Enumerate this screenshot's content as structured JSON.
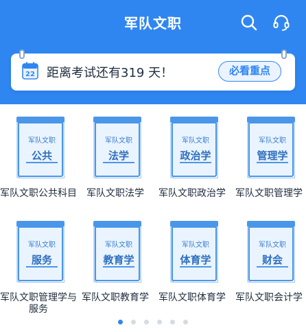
{
  "header": {
    "title": "军队文职",
    "icons": [
      "search-icon",
      "headset-icon"
    ],
    "background": "#2f86f1"
  },
  "countdown": {
    "calendar_day": "22",
    "text": "距离考试还有319 天！",
    "days": 319,
    "action_label": "必看重点"
  },
  "subjects": [
    {
      "sub": "军队文职",
      "main": "公共",
      "label": "军队文职公共科目"
    },
    {
      "sub": "军队文职",
      "main": "法学",
      "label": "军队文职法学"
    },
    {
      "sub": "军队文职",
      "main": "政治学",
      "label": "军队文职政治学"
    },
    {
      "sub": "军队文职",
      "main": "管理学",
      "label": "军队文职管理学"
    },
    {
      "sub": "军队文职",
      "main": "服务",
      "label": "军队文职管理学与服务"
    },
    {
      "sub": "军队文职",
      "main": "教育学",
      "label": "军队文职教育学"
    },
    {
      "sub": "军队文职",
      "main": "体育学",
      "label": "军队文职体育学"
    },
    {
      "sub": "军队文职",
      "main": "财会",
      "label": "军队文职会计学"
    }
  ],
  "pager": {
    "pages": 6,
    "current": 1
  },
  "colors": {
    "accent": "#2f86f1",
    "book_blue": "#4a96e8",
    "text": "#1f2d3d"
  }
}
